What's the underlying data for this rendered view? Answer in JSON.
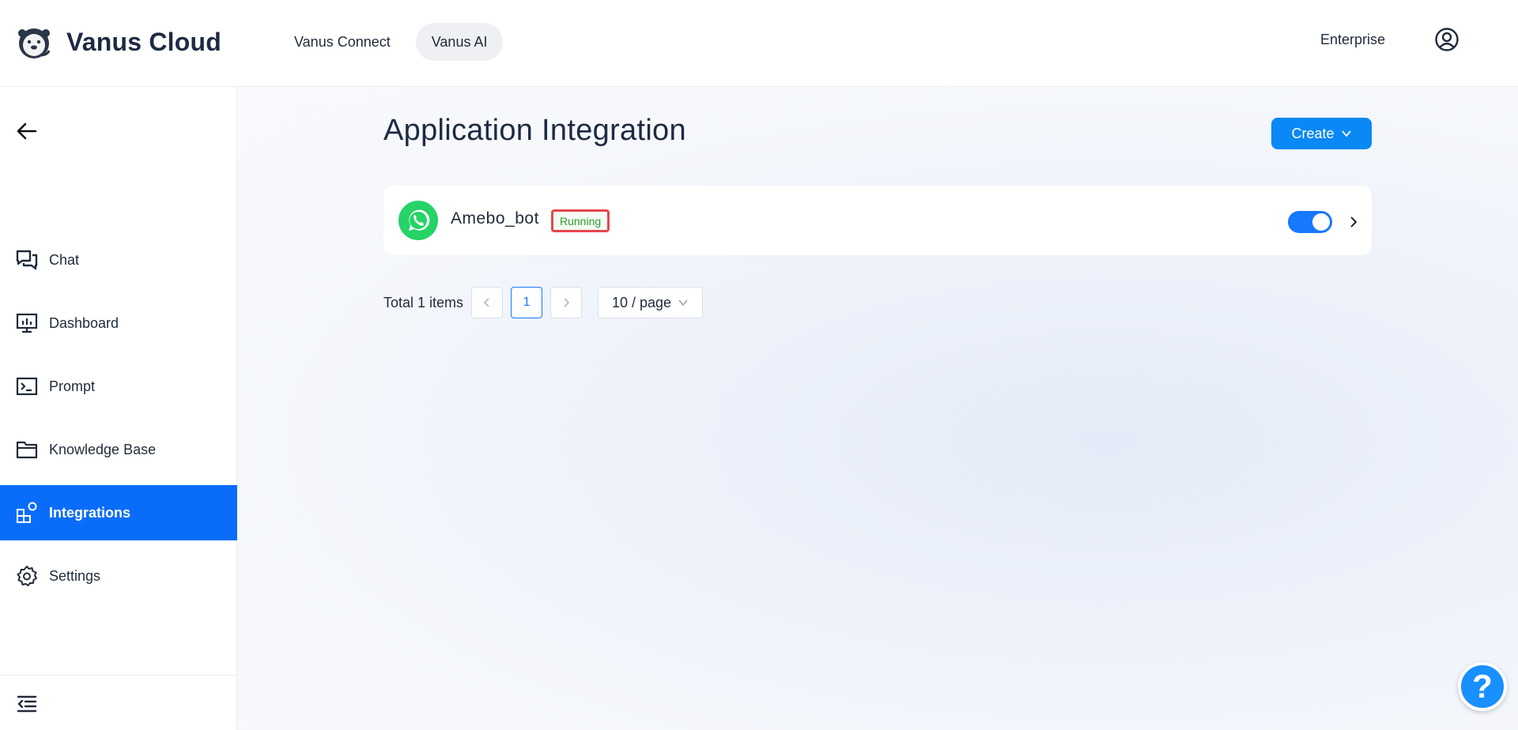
{
  "header": {
    "brand": "Vanus Cloud",
    "nav": [
      "Vanus Connect",
      "Vanus AI"
    ],
    "active_nav": "Vanus AI",
    "plan": "Enterprise"
  },
  "sidebar": {
    "items": [
      {
        "label": "Chat",
        "icon": "chat-icon"
      },
      {
        "label": "Dashboard",
        "icon": "dashboard-icon"
      },
      {
        "label": "Prompt",
        "icon": "terminal-icon"
      },
      {
        "label": "Knowledge Base",
        "icon": "folder-icon"
      },
      {
        "label": "Integrations",
        "icon": "integrations-icon",
        "active": true
      },
      {
        "label": "Settings",
        "icon": "gear-icon"
      }
    ]
  },
  "main": {
    "title": "Application Integration",
    "create_label": "Create",
    "integrations": [
      {
        "name": "Amebo_bot",
        "status": "Running",
        "platform_icon": "whatsapp-icon",
        "enabled": true
      }
    ],
    "pagination": {
      "total": "Total 1 items",
      "current_page": "1",
      "page_size": "10 / page"
    }
  },
  "help": {
    "label": "?"
  },
  "colors": {
    "accent": "#0a6dfa",
    "button": "#0a88f5",
    "toggle": "#1677ff",
    "status_green": "#2f9c2f",
    "highlight_red": "#e5484d",
    "whatsapp": "#25d366"
  }
}
